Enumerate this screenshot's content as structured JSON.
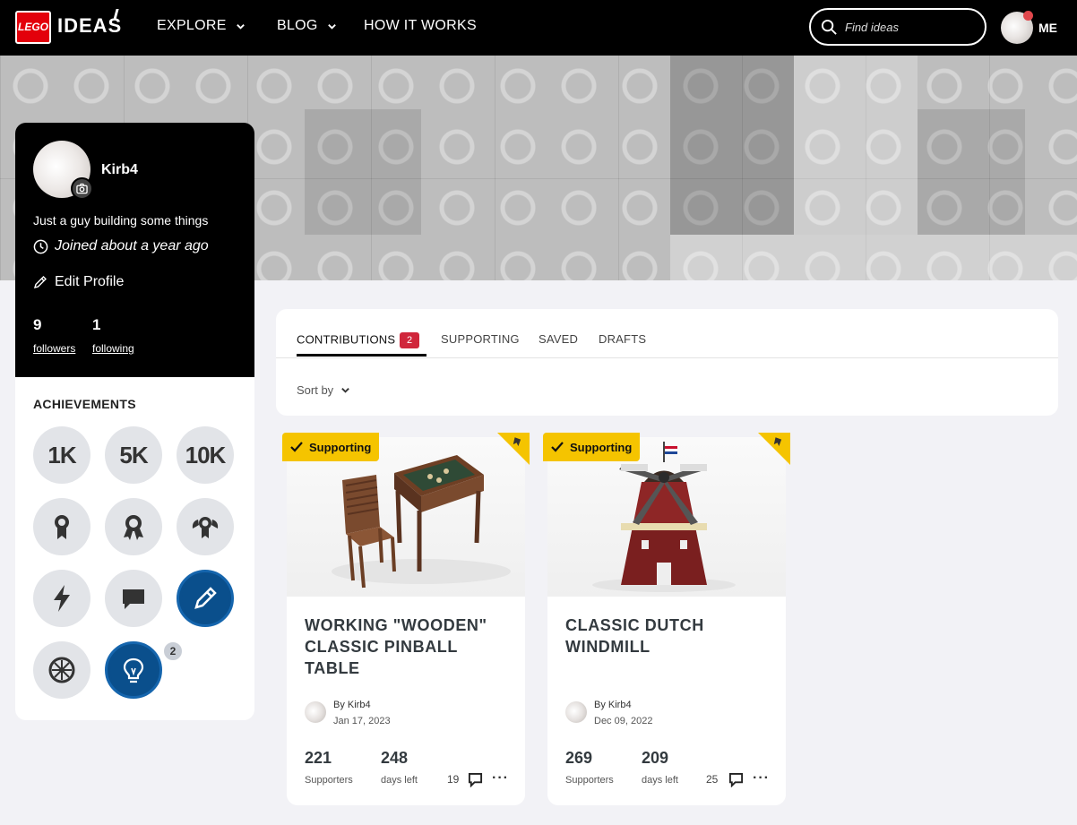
{
  "nav": {
    "logo_text": "LEGO",
    "ideas_text": "IDEAS",
    "explore": "EXPLORE",
    "blog": "BLOG",
    "how_it_works": "HOW IT WORKS",
    "search_placeholder": "Find ideas",
    "me": "ME"
  },
  "profile": {
    "username": "Kirb4",
    "bio": "Just a guy building some things",
    "joined": "Joined about a year ago",
    "edit": "Edit Profile",
    "followers_count": "9",
    "followers_label": "followers",
    "following_count": "1",
    "following_label": "following"
  },
  "achievements": {
    "title": "ACHIEVEMENTS",
    "badges": [
      {
        "label": "1K",
        "icon": "1k-badge",
        "earned": false
      },
      {
        "label": "5K",
        "icon": "5k-badge",
        "earned": false
      },
      {
        "label": "10K",
        "icon": "10k-badge",
        "earned": false
      },
      {
        "icon": "medal-icon",
        "earned": false
      },
      {
        "icon": "rosette-icon",
        "earned": false
      },
      {
        "icon": "winged-medal-icon",
        "earned": false
      },
      {
        "icon": "lightning-icon",
        "earned": false
      },
      {
        "icon": "chat-icon",
        "earned": false
      },
      {
        "icon": "pencil-icon",
        "earned": true
      },
      {
        "icon": "compass-icon",
        "earned": false
      },
      {
        "icon": "lightbulb-icon",
        "earned": true,
        "count": "2"
      }
    ]
  },
  "tabs": {
    "contributions": "CONTRIBUTIONS",
    "contributions_count": "2",
    "supporting": "SUPPORTING",
    "saved": "SAVED",
    "drafts": "DRAFTS",
    "sort_by": "Sort by"
  },
  "cards": [
    {
      "tag": "Supporting",
      "title": "WORKING \"WOODEN\" CLASSIC PINBALL TABLE",
      "by": "By Kirb4",
      "date": "Jan 17, 2023",
      "supporters": "221",
      "supporters_label": "Supporters",
      "days_left": "248",
      "days_left_label": "days left",
      "comments": "19",
      "more": "···"
    },
    {
      "tag": "Supporting",
      "title": "CLASSIC DUTCH WINDMILL",
      "by": "By Kirb4",
      "date": "Dec 09, 2022",
      "supporters": "269",
      "supporters_label": "Supporters",
      "days_left": "209",
      "days_left_label": "days left",
      "comments": "25",
      "more": "···"
    }
  ],
  "colors": {
    "nav_bg": "#000000",
    "brand_red": "#e3000b",
    "support_yellow": "#f5c400",
    "count_red": "#d0263b",
    "badge_blue": "#0a4f8c",
    "badge_grey": "#e2e4e8"
  }
}
